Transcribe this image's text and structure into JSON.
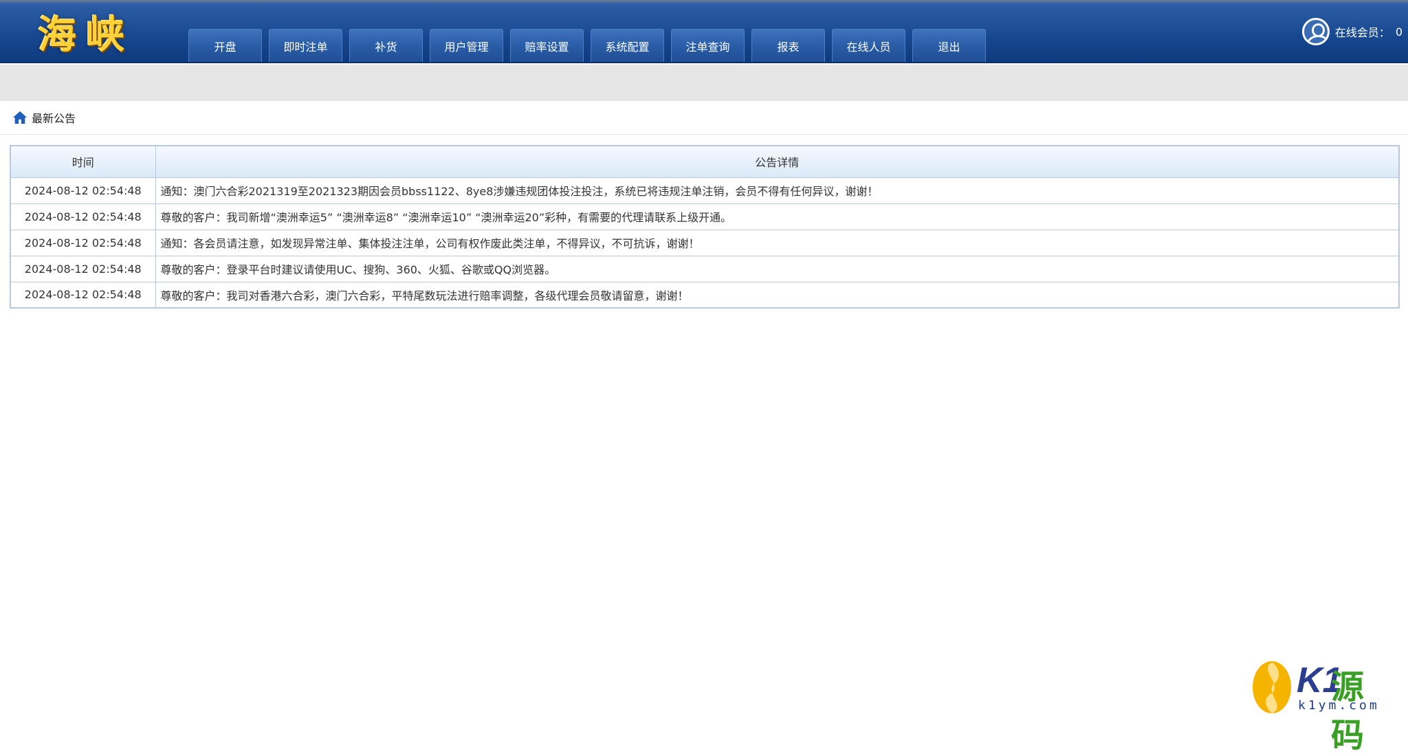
{
  "header": {
    "logo_text": "海峡",
    "nav_items": [
      "开盘",
      "即时注单",
      "补货",
      "用户管理",
      "赔率设置",
      "系统配置",
      "注单查询",
      "报表",
      "在线人员",
      "退出"
    ],
    "online_label": "在线会员：",
    "online_count": "0",
    "accent_color": "#1a4a92",
    "logo_color": "#ffd23a"
  },
  "breadcrumb": {
    "icon": "home-icon",
    "label": "最新公告"
  },
  "announcements": {
    "columns": [
      "时间",
      "公告详情"
    ],
    "rows": [
      {
        "time": "2024-08-12 02:54:48",
        "detail": "通知：澳门六合彩2021319至2021323期因会员bbss1122、8ye8涉嫌违规团体投注投注，系统已将违规注单注销，会员不得有任何异议，谢谢！"
      },
      {
        "time": "2024-08-12 02:54:48",
        "detail": "尊敬的客户：我司新增“澳洲幸运5” “澳洲幸运8” “澳洲幸运10” “澳洲幸运20”彩种，有需要的代理请联系上级开通。"
      },
      {
        "time": "2024-08-12 02:54:48",
        "detail": "通知：各会员请注意，如发现异常注单、集体投注注单，公司有权作废此类注单，不得异议，不可抗诉，谢谢！"
      },
      {
        "time": "2024-08-12 02:54:48",
        "detail": "尊敬的客户：登录平台时建议请使用UC、搜狗、360、火狐、谷歌或QQ浏览器。"
      },
      {
        "time": "2024-08-12 02:54:48",
        "detail": "尊敬的客户：我司对香港六合彩，澳门六合彩，平特尾数玩法进行赔率调整，各级代理会员敬请留意，谢谢！"
      }
    ]
  },
  "watermark": {
    "brand_latin": "K1",
    "brand_zh": "源码",
    "url": "k1ym.com"
  }
}
